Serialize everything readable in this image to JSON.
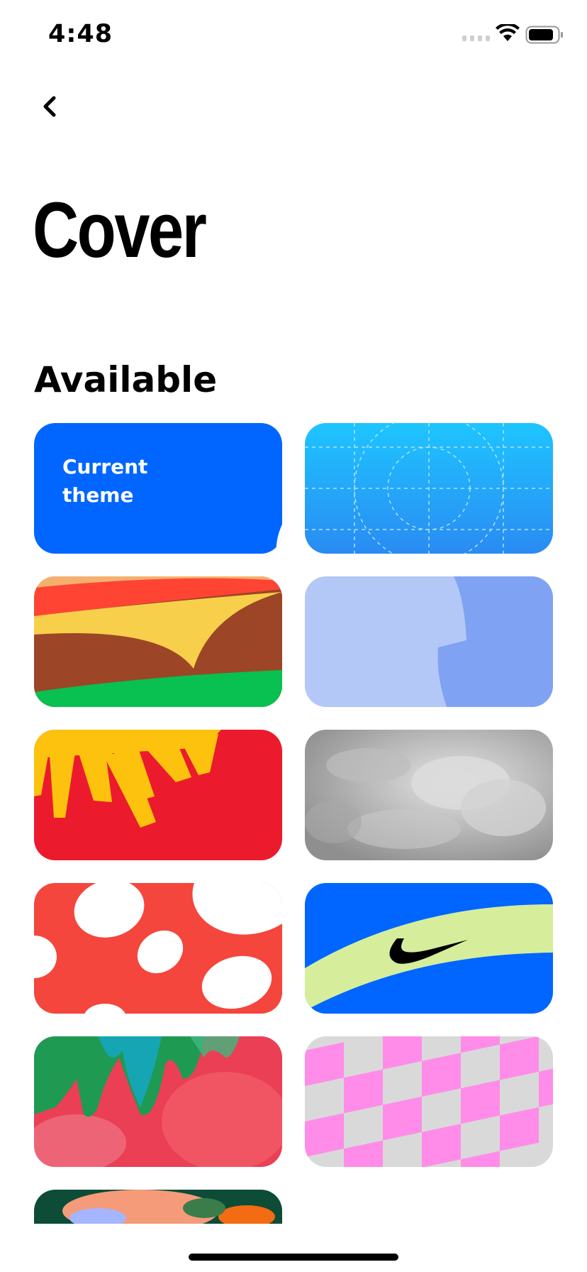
{
  "status_bar": {
    "time": "4:48",
    "icons": [
      "cellular-signal-icon",
      "wifi-icon",
      "battery-icon"
    ]
  },
  "nav": {
    "back_icon": "chevron-left-icon"
  },
  "title": "Cover",
  "section": {
    "title": "Available"
  },
  "themes": [
    {
      "name": "current",
      "label": "Current\ntheme",
      "selected": true,
      "color": "#0066ff",
      "icon": "checkmark-circle-icon"
    },
    {
      "name": "blue-grid",
      "colors": [
        "#1ec5ff",
        "#2a8bf2"
      ]
    },
    {
      "name": "burger",
      "colors": [
        "#ff4433",
        "#9c4527",
        "#f8cf4a",
        "#08c150"
      ]
    },
    {
      "name": "periwinkle",
      "colors": [
        "#b4c8f7",
        "#80a2f2"
      ]
    },
    {
      "name": "sun",
      "colors": [
        "#ec1a2d",
        "#fcc20e"
      ]
    },
    {
      "name": "clouds",
      "colors": [
        "#9a9a9a",
        "#d9d9d9"
      ]
    },
    {
      "name": "polka-dots",
      "colors": [
        "#f4463c",
        "#ffffff"
      ]
    },
    {
      "name": "swoosh",
      "colors": [
        "#0066ff",
        "#d6ee9c",
        "#000000"
      ],
      "icon": "swoosh-logo-icon"
    },
    {
      "name": "watercolor",
      "colors": [
        "#ea3f55",
        "#1f9a52",
        "#15a7c3"
      ]
    },
    {
      "name": "checkerboard",
      "colors": [
        "#d9d9d9",
        "#ff8ce8"
      ]
    },
    {
      "name": "painted",
      "colors": [
        "#0d4c36",
        "#f59b7a",
        "#a5b5ff"
      ]
    }
  ]
}
